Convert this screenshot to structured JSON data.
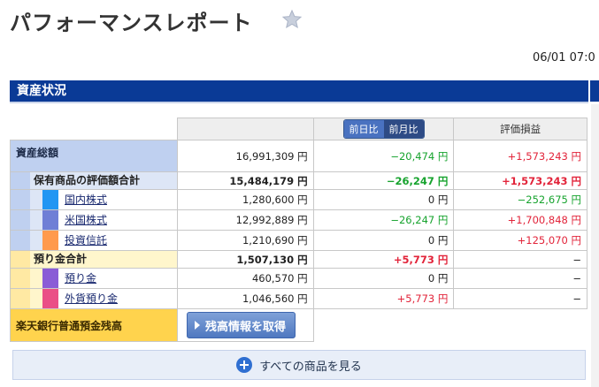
{
  "page": {
    "title": "パフォーマンスレポート",
    "datetime": "06/01 07:0"
  },
  "section": {
    "title": "資産状況"
  },
  "header": {
    "tab_daily": "前日比",
    "tab_monthly": "前月比",
    "pl": "評価損益"
  },
  "total": {
    "label": "資産総額",
    "value": "16,991,309 円",
    "diff": "−20,474 円",
    "pl": "+1,573,243 円"
  },
  "holdings": {
    "label": "保有商品の評価額合計",
    "value": "15,484,179 円",
    "diff": "−26,247 円",
    "pl": "+1,573,243 円",
    "items": [
      {
        "label": "国内株式",
        "value": "1,280,600 円",
        "diff": "0 円",
        "pl": "−252,675 円",
        "color": "#2196f3"
      },
      {
        "label": "米国株式",
        "value": "12,992,889 円",
        "diff": "−26,247 円",
        "pl": "+1,700,848 円",
        "color": "#6f7fd6"
      },
      {
        "label": "投資信託",
        "value": "1,210,690 円",
        "diff": "0 円",
        "pl": "+125,070 円",
        "color": "#ff9a4d"
      }
    ]
  },
  "deposits": {
    "label": "預り金合計",
    "value": "1,507,130 円",
    "diff": "+5,773 円",
    "pl": "−",
    "items": [
      {
        "label": "預り金",
        "value": "460,570 円",
        "diff": "0 円",
        "pl": "−",
        "color": "#8a5cd6"
      },
      {
        "label": "外貨預り金",
        "value": "1,046,560 円",
        "diff": "+5,773 円",
        "pl": "−",
        "color": "#ea4f86"
      }
    ]
  },
  "bank": {
    "label": "楽天銀行普通預金残高",
    "button": "残高情報を取得"
  },
  "footer": {
    "more": "すべての商品を見る"
  },
  "colors": {
    "section_bar": "#0a3a96",
    "green": "#17a32e",
    "red": "#e2243a"
  }
}
